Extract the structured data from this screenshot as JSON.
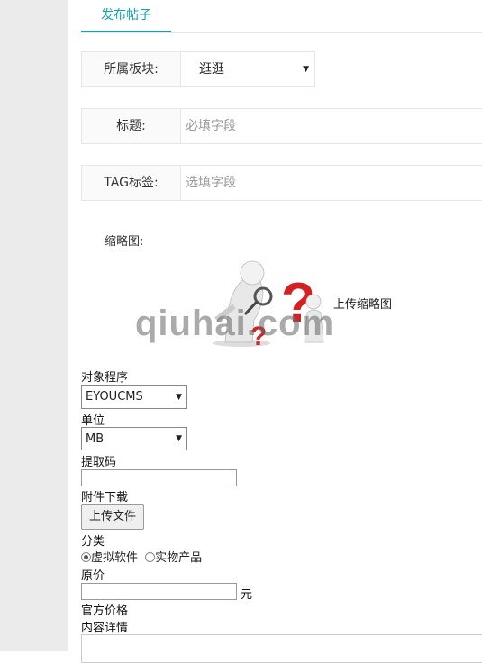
{
  "tabs": [
    {
      "label": "发布帖子"
    }
  ],
  "board": {
    "label": "所属板块:",
    "value": "逛逛"
  },
  "title": {
    "label": "标题:",
    "placeholder": "必填字段"
  },
  "tags": {
    "label": "TAG标签:",
    "placeholder": "选填字段"
  },
  "thumbnail": {
    "label": "缩略图:",
    "upload_text": "上传缩略图",
    "watermark": "qiuhai.com"
  },
  "target_program": {
    "label": "对象程序",
    "value": "EYOUCMS"
  },
  "unit": {
    "label": "单位",
    "value": "MB"
  },
  "code": {
    "label": "提取码",
    "value": ""
  },
  "attachment": {
    "label": "附件下载",
    "button": "上传文件"
  },
  "category": {
    "label": "分类",
    "options": [
      "虚拟软件",
      "实物产品"
    ],
    "selected": "虚拟软件"
  },
  "price": {
    "label": "原价",
    "value": "",
    "unit": "元"
  },
  "official_price": {
    "label": "官方价格"
  },
  "details": {
    "label": "内容详情"
  },
  "colors": {
    "accent": "#16a0a8",
    "sidebar": "#ebebeb",
    "question_mark": "#d42020"
  }
}
